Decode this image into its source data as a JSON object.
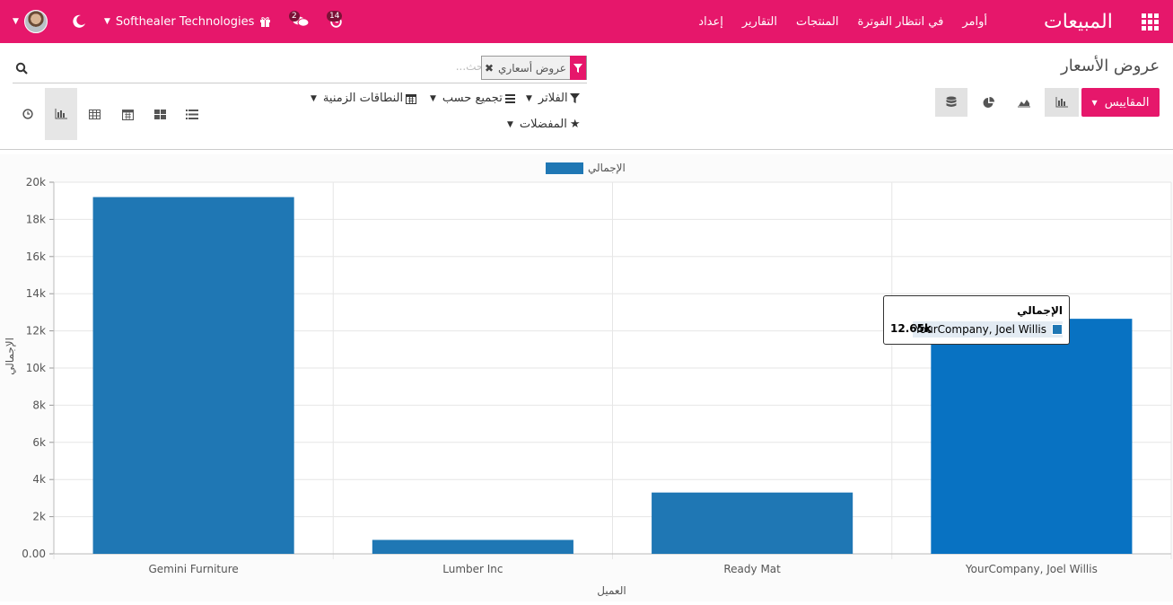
{
  "navbar": {
    "brand": "المبيعات",
    "menu": [
      "أوامر",
      "في انتظار الفوترة",
      "المنتجات",
      "التقارير",
      "إعداد"
    ],
    "company": "Softhealer Technologies",
    "messages_badge": "2",
    "activities_badge": "14",
    "accent_color": "#e6176b"
  },
  "control_panel": {
    "breadcrumb": "عروض الأسعار",
    "search": {
      "facet_value": "عروض أسعاري",
      "placeholder": "بحث..."
    },
    "measures_label": "المقاييس",
    "filters_label": "الفلاتر",
    "group_by_label": "تجميع حسب",
    "date_ranges_label": "النطاقات الزمنية",
    "favorites_label": "المفضلات"
  },
  "chart_data": {
    "type": "bar",
    "categories": [
      "Gemini Furniture",
      "Lumber Inc",
      "Ready Mat",
      "YourCompany, Joel Willis"
    ],
    "series": [
      {
        "name": "الإجمالي",
        "values": [
          19200,
          750,
          3300,
          12650
        ],
        "color": "#1f77b4"
      }
    ],
    "xlabel": "العميل",
    "ylabel": "الإجمالي",
    "ylim": [
      0,
      20000
    ],
    "yticks": [
      "0.00",
      "2k",
      "4k",
      "6k",
      "8k",
      "10k",
      "12k",
      "14k",
      "16k",
      "18k",
      "20k"
    ],
    "grid": true,
    "legend": "top-center"
  },
  "tooltip": {
    "title": "الإجمالي",
    "label": "YourCompany, Joel Willis",
    "value": "12.65k"
  }
}
